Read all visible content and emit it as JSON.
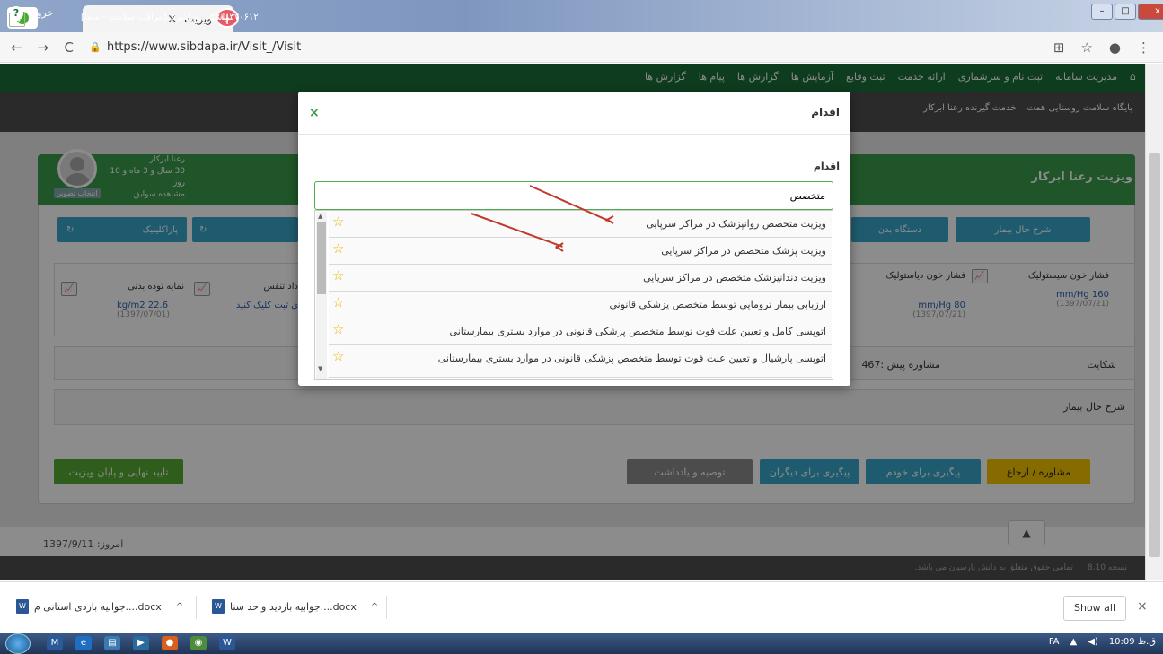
{
  "browser": {
    "tab_title": "ویزیت",
    "tab_close": "×",
    "new_tab": "+",
    "url": "https://www.sibdapa.ir/Visit_/Visit",
    "back": "←",
    "forward": "→",
    "reload": "C"
  },
  "navbar": {
    "logout": "خروج",
    "help": "?",
    "menu": [
      "مدیریت سامانه",
      "ثبت نام و سرشماری",
      "ارائه خدمت",
      "ثبت وقایع",
      "آزمایش ها",
      "گزارش ها",
      "پیام ها",
      "گزارش ها"
    ],
    "facility": "پایگاه سلامت روستایی همت",
    "service_receiver": "خدمت گیرنده رعنا ابرکار",
    "user": "راشین پوراشرف[مراقب سلامت - ماما]",
    "user_code": "۳۷۱۰۳۷۰۶۱۲"
  },
  "visit": {
    "title": "ویزیت رعنا ابرکار",
    "patient_name": "رعنا ابرکار",
    "patient_age": "30 سال و 3 ماه و 10 روز",
    "history_link": "مشاهده سوابق",
    "change_photo": "انتخاب تصویر",
    "tabs": {
      "sharh": "شرح حال بیمار",
      "dastgah": "دستگاه بدن",
      "paraclinic": "پاراکلینیک"
    },
    "vitals": {
      "systolic_label": "فشار خون سیستولیک",
      "systolic_value": "mm/Hg 160",
      "systolic_date": "(1397/07/21)",
      "diastolic_label": "فشار خون دیاستولیک",
      "diastolic_value": "mm/Hg 80",
      "diastolic_date": "(1397/07/21)",
      "resp_label": "داد تنفس",
      "resp_value": "ی ثبت کلیک کنید",
      "bmi_label": "نمایه توده بدنی",
      "bmi_value": "kg/m2 22.6",
      "bmi_date": "(1397/07/01)"
    },
    "complaint_label": "شکایت",
    "complaint_value": "467: مشاوره پیش",
    "history_section": "شرح حال بیمار",
    "actions": {
      "moshavere": "مشاوره / ارجاع",
      "peygiri_khod": "پیگیری برای خودم",
      "peygiri_digaran": "پیگیری برای دیگران",
      "tosie": "توصیه و یادداشت",
      "taeed": "تایید نهایی و پایان ویزیت"
    },
    "today_label": "امروز: 1397/9/11",
    "version": "نسخه 8.10",
    "copyright": "تمامی حقوق متعلق به دانش پارسیان می باشد."
  },
  "modal": {
    "title": "اقدام",
    "close": "×",
    "field_label": "اقدام",
    "search_value": "متخصص",
    "items": [
      "ویزیت متخصص روانپزشک در مراکز سرپایی",
      "ویزیت پزشک متخصص در مراکز سرپایی",
      "ویزیت دندانپزشک متخصص در مراکز سرپایی",
      "ارزیابی بیمار ترومایی توسط متخصص پزشکی قانونی",
      "اتوپسی کامل و تعیین علت فوت توسط متخصص پزشکی قانونی در موارد بستری بیمارستانی",
      "اتوپسی پارشیال و تعیین علت فوت توسط متخصص پزشکی قانونی در موارد بستری بیمارستانی"
    ]
  },
  "downloads": {
    "item1": "جوابیه بازدید واحد ستا....docx",
    "item2": "جوابیه بازدی استانی م....docx",
    "show_all": "Show all",
    "close": "×"
  },
  "taskbar": {
    "lang": "FA",
    "time": "10:09 ق.ظ"
  },
  "colors": {
    "navbar": "#1a6e37",
    "header_green": "#3a9b4a",
    "teal": "#3aa6c8",
    "yellow": "#f5c400",
    "arrow_red": "#c0392b"
  }
}
